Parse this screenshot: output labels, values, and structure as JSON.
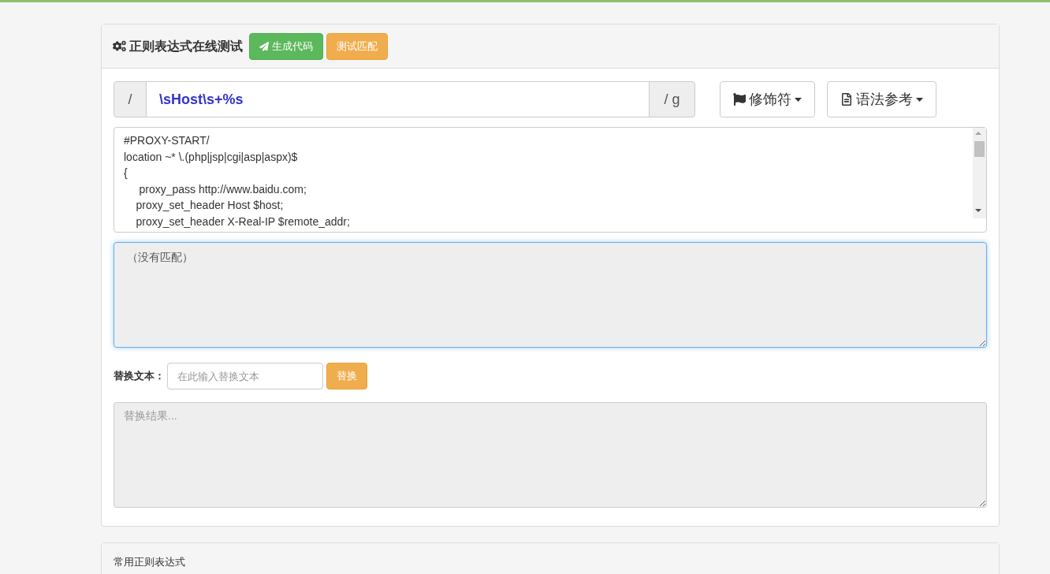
{
  "panel": {
    "title": "正则表达式在线测试",
    "buttons": [
      {
        "label": "生成代码",
        "kind": "success"
      },
      {
        "label": "测试匹配",
        "kind": "warning"
      }
    ]
  },
  "regex": {
    "prefix": "/",
    "value": "\\sHost\\s+%s",
    "suffix": "/ g"
  },
  "dropdowns": [
    {
      "label": "修饰符",
      "kind": "flag"
    },
    {
      "label": "语法参考",
      "kind": "doc"
    }
  ],
  "source_text": [
    "#PROXY-START/",
    "location ~* \\.(php|jsp|cgi|asp|aspx)$",
    "{",
    "\t proxy_pass http://www.baidu.com;",
    "    proxy_set_header Host $host;",
    "    proxy_set_header X-Real-IP $remote_addr;"
  ],
  "match_result": {
    "value": "（没有匹配）",
    "focused": true
  },
  "replace": {
    "label": "替换文本：",
    "placeholder": "在此输入替换文本",
    "button": "替换"
  },
  "replace_result": {
    "placeholder": "替换结果..."
  },
  "second_panel": {
    "title": "常用正则表达式"
  }
}
